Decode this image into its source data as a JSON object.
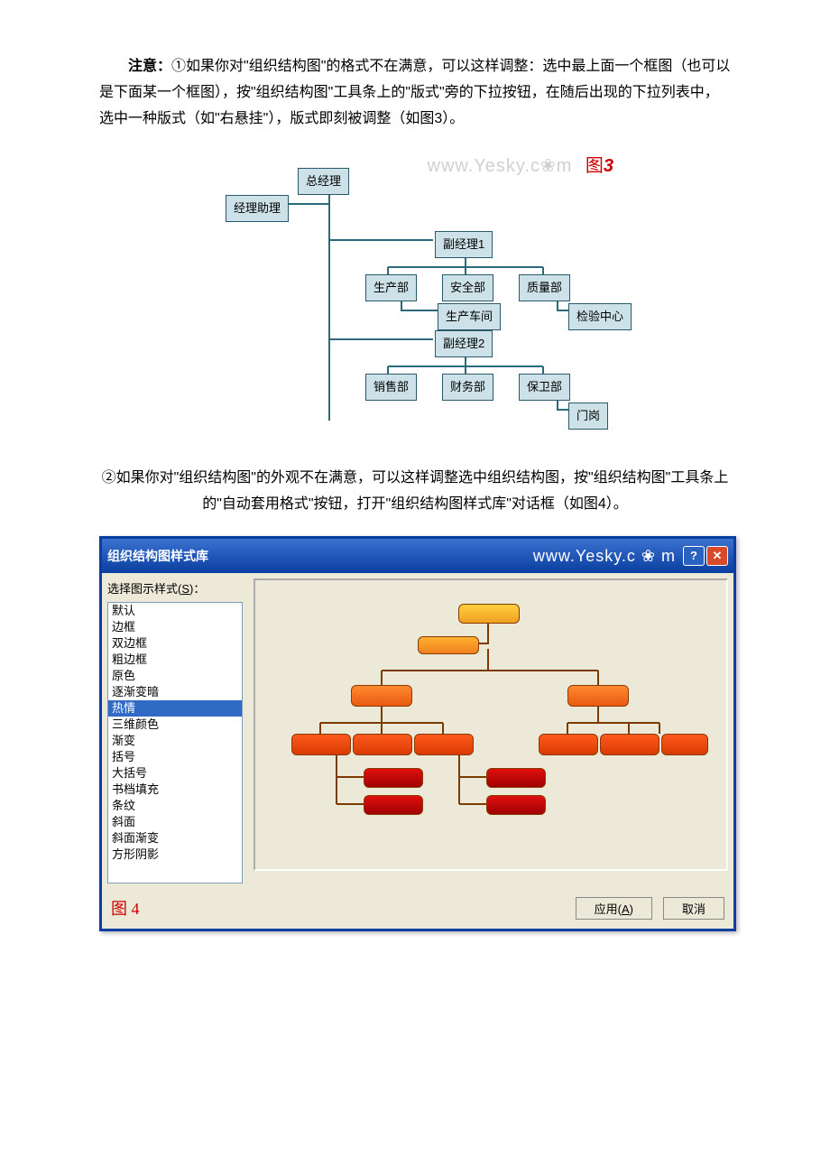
{
  "para1": {
    "lead": "注意：",
    "body": "①如果你对\"组织结构图\"的格式不在满意，可以这样调整：选中最上面一个框图（也可以是下面某一个框图），按\"组织结构图\"工具条上的\"版式\"旁的下拉按钮，在随后出现的下拉列表中，选中一种版式（如\"右悬挂\"），版式即刻被调整（如图3）。"
  },
  "fig3": {
    "watermark_url": "www.Yesky.c❀m",
    "label_zh": "图",
    "label_n": "3",
    "nodes": {
      "root": "总经理",
      "asst": "经理助理",
      "vp1": "副经理1",
      "prod": "生产部",
      "safe": "安全部",
      "qual": "质量部",
      "ws": "生产车间",
      "insp": "检验中心",
      "vp2": "副经理2",
      "sale": "销售部",
      "fin": "财务部",
      "sec": "保卫部",
      "gate": "门岗"
    }
  },
  "para2": "②如果你对\"组织结构图\"的外观不在满意，可以这样调整选中组织结构图，按\"组织结构图\"工具条上的\"自动套用格式\"按钮，打开\"组织结构图样式库\"对话框（如图4）。",
  "dlg": {
    "title": "组织结构图样式库",
    "turl": "www.Yesky.c ❀ m",
    "help": "?",
    "close": "✕",
    "listlabel_pre": "选择图示样式(",
    "listlabel_u": "S",
    "listlabel_post": ")：",
    "items": [
      "默认",
      "边框",
      "双边框",
      "粗边框",
      "原色",
      "逐渐变暗",
      "热情",
      "三维颜色",
      "渐变",
      "括号",
      "大括号",
      "书档填充",
      "条纹",
      "斜面",
      "斜面渐变",
      "方形阴影"
    ],
    "selected_index": 6,
    "apply_pre": "应用(",
    "apply_u": "A",
    "apply_post": ")",
    "cancel": "取消",
    "figlab": "图 4"
  },
  "chart_data": {
    "type": "tree",
    "title": "组织结构图（右悬挂版式）",
    "root": "总经理",
    "assistant": "经理助理",
    "children": [
      {
        "name": "副经理1",
        "children": [
          {
            "name": "生产部",
            "children": [
              {
                "name": "生产车间"
              }
            ]
          },
          {
            "name": "安全部"
          },
          {
            "name": "质量部",
            "children": [
              {
                "name": "检验中心"
              }
            ]
          }
        ]
      },
      {
        "name": "副经理2",
        "children": [
          {
            "name": "销售部"
          },
          {
            "name": "财务部"
          },
          {
            "name": "保卫部",
            "children": [
              {
                "name": "门岗"
              }
            ]
          }
        ]
      }
    ]
  }
}
